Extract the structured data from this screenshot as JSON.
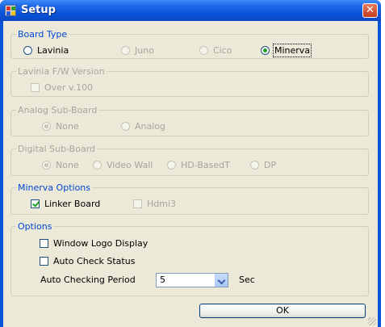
{
  "window": {
    "title": "Setup",
    "close_glyph": "✕"
  },
  "board_type": {
    "legend": "Board Type",
    "options": [
      "Lavinia",
      "Juno",
      "Cico",
      "Minerva"
    ],
    "selected": "Minerva"
  },
  "lavinia_fw": {
    "legend": "Lavinia F/W Version",
    "checkbox": "Over v.100"
  },
  "analog_sub": {
    "legend": "Analog Sub-Board",
    "options": [
      "None",
      "Analog"
    ],
    "selected": "None"
  },
  "digital_sub": {
    "legend": "Digital Sub-Board",
    "options": [
      "None",
      "Video Wall",
      "HD-BasedT",
      "DP"
    ],
    "selected": "None"
  },
  "minerva_options": {
    "legend": "Minerva Options",
    "linker": "Linker Board",
    "hdmi3": "Hdmi3",
    "linker_checked": true
  },
  "options": {
    "legend": "Options",
    "window_logo": "Window Logo Display",
    "auto_check": "Auto Check Status",
    "period_label": "Auto Checking Period",
    "period_value": "5",
    "period_unit": "Sec"
  },
  "ok_label": "OK",
  "colors": {
    "accent": "#0046d5",
    "disabled": "#a7a69a",
    "titlebar": "#0851d6"
  }
}
